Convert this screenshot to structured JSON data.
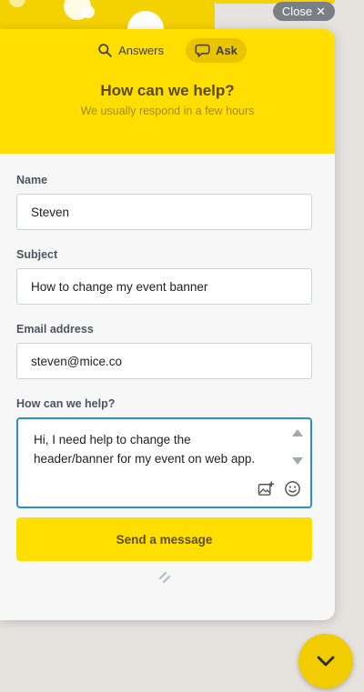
{
  "widget": {
    "close_label": "Close",
    "tabs": [
      {
        "label": "Answers",
        "icon": "search-icon",
        "active": false
      },
      {
        "label": "Ask",
        "icon": "chat-bubble-icon",
        "active": true
      }
    ],
    "title": "How can we help?",
    "subtitle": "We usually respond in a few hours"
  },
  "form": {
    "name": {
      "label": "Name",
      "value": "Steven"
    },
    "subject": {
      "label": "Subject",
      "value": "How to change my event banner"
    },
    "email": {
      "label": "Email address",
      "value": "steven@mice.co"
    },
    "message": {
      "label": "How can we help?",
      "value": "Hi, I need help to change the header/banner for my event on web app."
    },
    "send_label": "Send a message"
  },
  "colors": {
    "accent": "#ffde00",
    "focus_border": "#2a8fd6",
    "close_pill": "#7a7f85"
  }
}
